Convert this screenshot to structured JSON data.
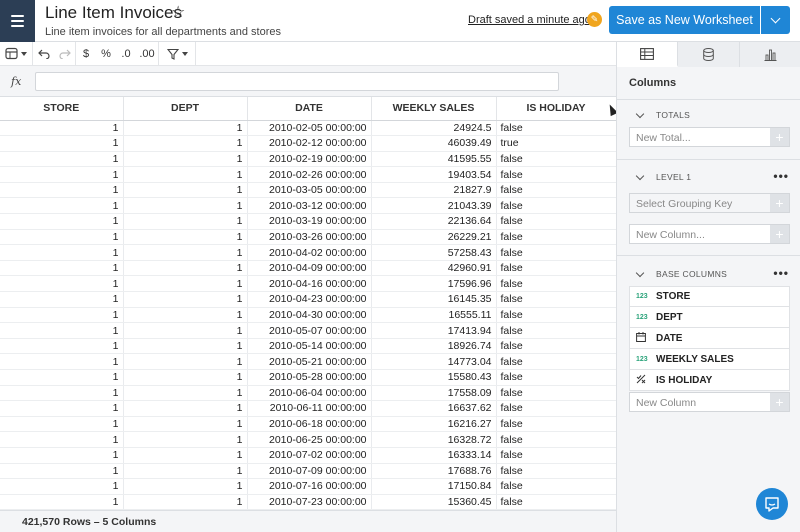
{
  "header": {
    "title": "Line Item Invoices",
    "subtitle": "Line item invoices for all departments and stores",
    "draft_status": "Draft saved a minute ago",
    "save_label": "Save as New Worksheet"
  },
  "toolbar": {
    "currency": "$",
    "percent": "%",
    "dec_decrease": ".0",
    "dec_increase": ".00"
  },
  "formula": {
    "fx_label": "fx",
    "value": ""
  },
  "grid": {
    "columns": [
      "STORE",
      "DEPT",
      "DATE",
      "WEEKLY SALES",
      "IS HOLIDAY"
    ],
    "rows": [
      [
        "1",
        "1",
        "2010-02-05 00:00:00",
        "24924.5",
        "false"
      ],
      [
        "1",
        "1",
        "2010-02-12 00:00:00",
        "46039.49",
        "true"
      ],
      [
        "1",
        "1",
        "2010-02-19 00:00:00",
        "41595.55",
        "false"
      ],
      [
        "1",
        "1",
        "2010-02-26 00:00:00",
        "19403.54",
        "false"
      ],
      [
        "1",
        "1",
        "2010-03-05 00:00:00",
        "21827.9",
        "false"
      ],
      [
        "1",
        "1",
        "2010-03-12 00:00:00",
        "21043.39",
        "false"
      ],
      [
        "1",
        "1",
        "2010-03-19 00:00:00",
        "22136.64",
        "false"
      ],
      [
        "1",
        "1",
        "2010-03-26 00:00:00",
        "26229.21",
        "false"
      ],
      [
        "1",
        "1",
        "2010-04-02 00:00:00",
        "57258.43",
        "false"
      ],
      [
        "1",
        "1",
        "2010-04-09 00:00:00",
        "42960.91",
        "false"
      ],
      [
        "1",
        "1",
        "2010-04-16 00:00:00",
        "17596.96",
        "false"
      ],
      [
        "1",
        "1",
        "2010-04-23 00:00:00",
        "16145.35",
        "false"
      ],
      [
        "1",
        "1",
        "2010-04-30 00:00:00",
        "16555.11",
        "false"
      ],
      [
        "1",
        "1",
        "2010-05-07 00:00:00",
        "17413.94",
        "false"
      ],
      [
        "1",
        "1",
        "2010-05-14 00:00:00",
        "18926.74",
        "false"
      ],
      [
        "1",
        "1",
        "2010-05-21 00:00:00",
        "14773.04",
        "false"
      ],
      [
        "1",
        "1",
        "2010-05-28 00:00:00",
        "15580.43",
        "false"
      ],
      [
        "1",
        "1",
        "2010-06-04 00:00:00",
        "17558.09",
        "false"
      ],
      [
        "1",
        "1",
        "2010-06-11 00:00:00",
        "16637.62",
        "false"
      ],
      [
        "1",
        "1",
        "2010-06-18 00:00:00",
        "16216.27",
        "false"
      ],
      [
        "1",
        "1",
        "2010-06-25 00:00:00",
        "16328.72",
        "false"
      ],
      [
        "1",
        "1",
        "2010-07-02 00:00:00",
        "16333.14",
        "false"
      ],
      [
        "1",
        "1",
        "2010-07-09 00:00:00",
        "17688.76",
        "false"
      ],
      [
        "1",
        "1",
        "2010-07-16 00:00:00",
        "17150.84",
        "false"
      ],
      [
        "1",
        "1",
        "2010-07-23 00:00:00",
        "15360.45",
        "false"
      ]
    ],
    "footer": "421,570 Rows – 5 Columns"
  },
  "panel": {
    "title": "Columns",
    "totals": {
      "label": "TOTALS",
      "placeholder": "New Total..."
    },
    "level1": {
      "label": "LEVEL 1",
      "grouping_placeholder": "Select Grouping Key",
      "column_placeholder": "New Column..."
    },
    "base": {
      "label": "BASE COLUMNS",
      "columns": [
        {
          "type": "123",
          "name": "STORE"
        },
        {
          "type": "123",
          "name": "DEPT"
        },
        {
          "type": "date-icon",
          "name": "DATE"
        },
        {
          "type": "123",
          "name": "WEEKLY SALES"
        },
        {
          "type": "boolean-icon",
          "name": "IS HOLIDAY"
        }
      ],
      "new_placeholder": "New Column"
    },
    "plus": "+",
    "dots": "•••"
  },
  "colors": {
    "accent": "#1f86d6",
    "nav": "#2c3e55",
    "pencil": "#f0a51e",
    "number_type": "#2aa37a"
  }
}
